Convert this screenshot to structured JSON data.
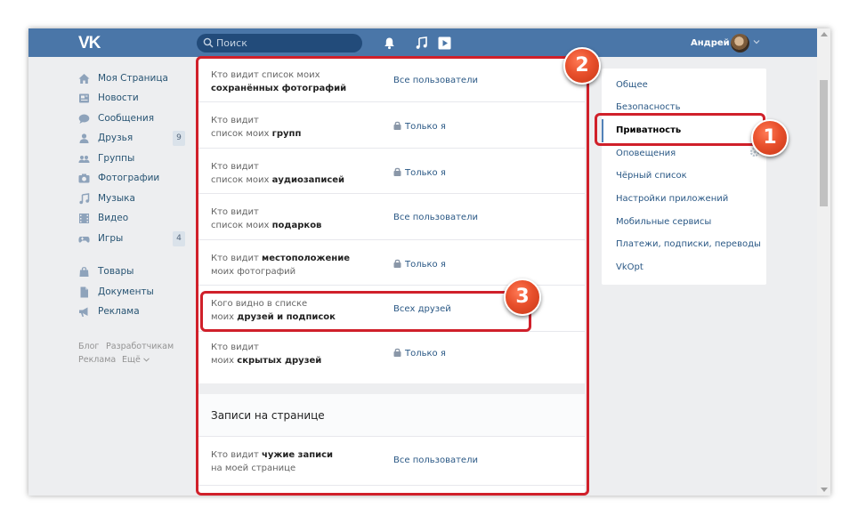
{
  "header": {
    "logo": "VK",
    "search_placeholder": "Поиск",
    "user_name": "Андрей"
  },
  "sidebar": {
    "items": [
      {
        "label": "Моя Страница",
        "icon": "home-icon"
      },
      {
        "label": "Новости",
        "icon": "news-icon"
      },
      {
        "label": "Сообщения",
        "icon": "messages-icon"
      },
      {
        "label": "Друзья",
        "icon": "friends-icon",
        "count": "9"
      },
      {
        "label": "Группы",
        "icon": "groups-icon"
      },
      {
        "label": "Фотографии",
        "icon": "camera-icon"
      },
      {
        "label": "Музыка",
        "icon": "music-icon"
      },
      {
        "label": "Видео",
        "icon": "video-icon"
      },
      {
        "label": "Игры",
        "icon": "games-icon",
        "count": "4"
      },
      {
        "label": "Товары",
        "icon": "bag-icon"
      },
      {
        "label": "Документы",
        "icon": "document-icon"
      },
      {
        "label": "Реклама",
        "icon": "megaphone-icon"
      }
    ],
    "footer": {
      "blog": "Блог",
      "developers": "Разработчикам",
      "ads": "Реклама",
      "more": "Ещё"
    }
  },
  "privacy": {
    "rows": [
      {
        "line1": "Кто видит список моих",
        "line2": "сохранённых фотографий",
        "value": "Все пользователи",
        "locked": false
      },
      {
        "line1": "Кто видит",
        "line2_pre": "список моих ",
        "line2_bold": "групп",
        "value": "Только я",
        "locked": true
      },
      {
        "line1": "Кто видит",
        "line2_pre": "список моих ",
        "line2_bold": "аудиозаписей",
        "value": "Только я",
        "locked": true
      },
      {
        "line1": "Кто видит",
        "line2_pre": "список моих ",
        "line2_bold": "подарков",
        "value": "Все пользователи",
        "locked": false
      },
      {
        "line1_pre": "Кто видит ",
        "line1_bold": "местоположение",
        "line2": "моих фотографий",
        "value": "Только я",
        "locked": true
      },
      {
        "line1": "Кого видно в списке",
        "line2_pre": "моих ",
        "line2_bold": "друзей и подписок",
        "value": "Всех друзей",
        "locked": false
      },
      {
        "line1": "Кто видит",
        "line2_pre": "моих ",
        "line2_bold": "скрытых друзей",
        "value": "Только я",
        "locked": true
      }
    ],
    "section_title": "Записи на странице",
    "wall_row": {
      "line1_pre": "Кто видит ",
      "line1_bold": "чужие записи",
      "line2": "на моей странице",
      "value": "Все пользователи"
    }
  },
  "settings_menu": {
    "items": [
      "Общее",
      "Безопасность",
      "Приватность",
      "Оповещения",
      "Чёрный список",
      "Настройки приложений",
      "Мобильные сервисы",
      "Платежи, подписки, переводы",
      "VkOpt"
    ],
    "active": "Приватность"
  },
  "badges": [
    "1",
    "2",
    "3"
  ],
  "colors": {
    "header": "#4a76a8",
    "link": "#2a5885",
    "highlight": "#d0202a",
    "badge": "#e8502c"
  }
}
